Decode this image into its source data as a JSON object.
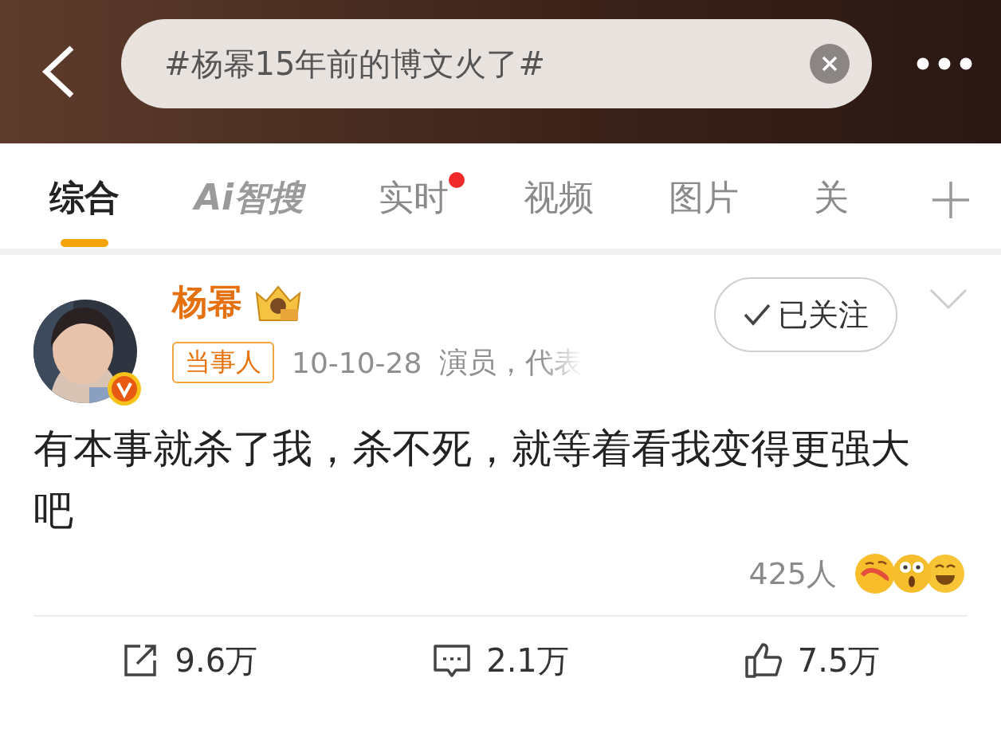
{
  "search": {
    "value": "#杨幂15年前的博文火了#"
  },
  "tabs": [
    {
      "label": "综合",
      "selected": true,
      "dot": false
    },
    {
      "label": "Ai智搜",
      "selected": false,
      "dot": false
    },
    {
      "label": "实时",
      "selected": false,
      "dot": true
    },
    {
      "label": "视频",
      "selected": false,
      "dot": false
    },
    {
      "label": "图片",
      "selected": false,
      "dot": false
    },
    {
      "label": "关",
      "selected": false,
      "dot": false
    }
  ],
  "post": {
    "author": {
      "name": "杨幂",
      "verified": true
    },
    "tag": "当事人",
    "date": "10-10-28",
    "bio": "演员，代表",
    "follow_button": "已关注",
    "text": "有本事就杀了我，杀不死，就等着看我变得更强大吧",
    "reactions_count": "425人",
    "actions": [
      {
        "kind": "repost",
        "count": "9.6万"
      },
      {
        "kind": "comment",
        "count": "2.1万"
      },
      {
        "kind": "like",
        "count": "7.5万"
      }
    ]
  }
}
